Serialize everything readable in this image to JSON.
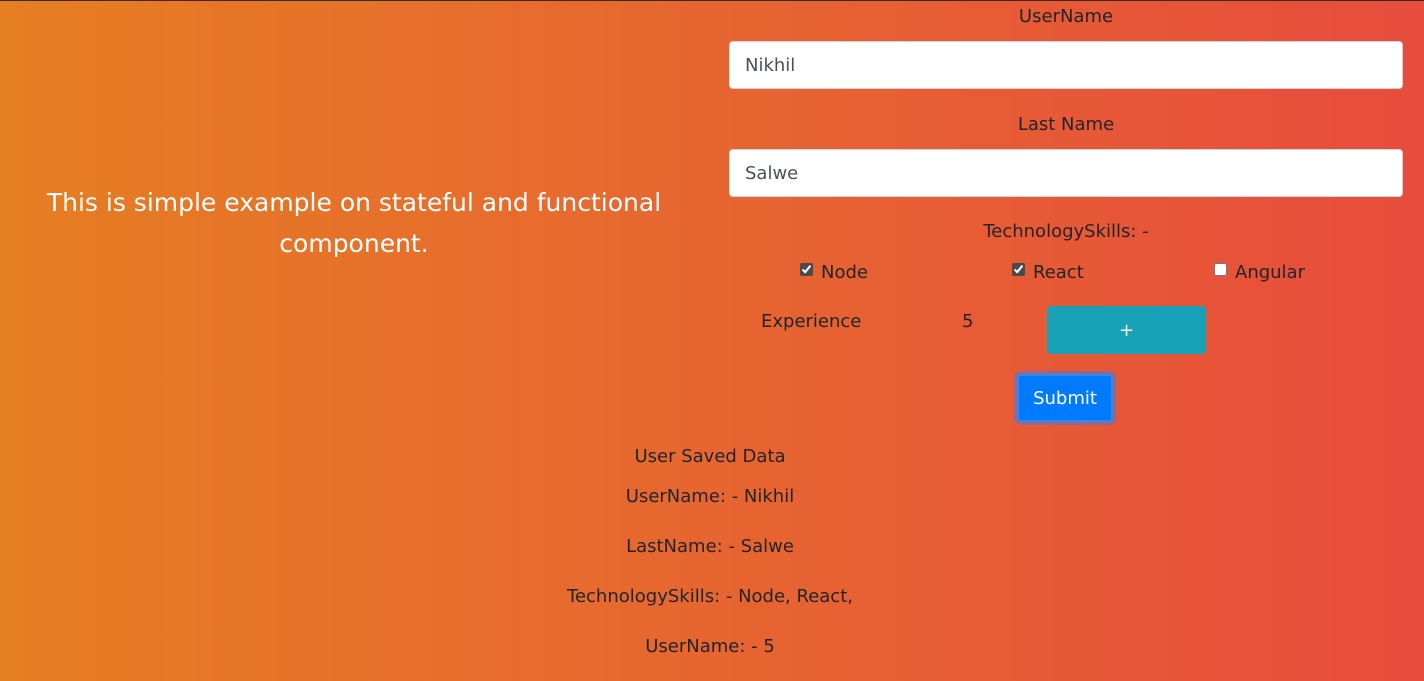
{
  "intro": {
    "text": "This is simple example on stateful and functional component."
  },
  "form": {
    "username_label": "UserName",
    "username_value": "Nikhil",
    "lastname_label": "Last Name",
    "lastname_value": "Salwe",
    "skills_label": "TechnologySkills: -",
    "skills": [
      {
        "label": "Node",
        "checked": true
      },
      {
        "label": "React",
        "checked": true
      },
      {
        "label": "Angular",
        "checked": false
      }
    ],
    "experience_label": "Experience",
    "experience_value": "5",
    "increment_label": "+",
    "submit_label": "Submit"
  },
  "saved": {
    "heading": "User Saved Data",
    "username_line": "UserName: - Nikhil",
    "lastname_line": "LastName: - Salwe",
    "skills_line": "TechnologySkills: - Node, React,",
    "experience_line": "UserName: - 5"
  },
  "colors": {
    "gradient_start": "#e67e22",
    "gradient_end": "#e74c3c",
    "increment_button": "#17a2b8",
    "submit_button": "#007bff"
  }
}
